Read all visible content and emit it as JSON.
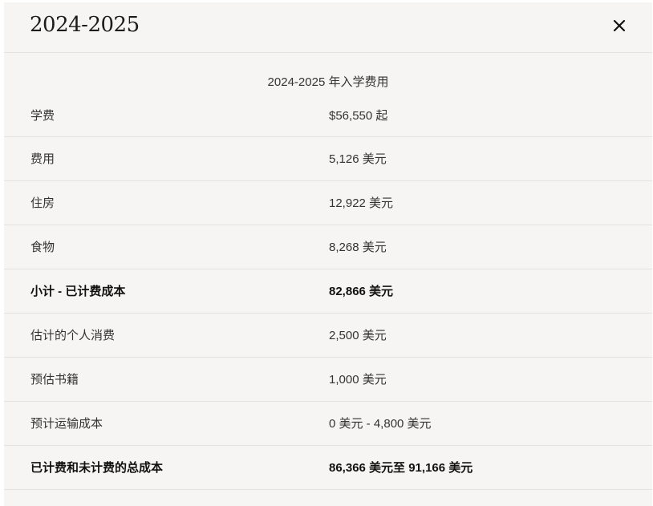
{
  "header": {
    "title": "2024-2025",
    "close_icon": "close-icon"
  },
  "table": {
    "caption": "2024-2025 年入学费用",
    "rows": [
      {
        "label": "学费",
        "value": "$56,550 起",
        "bold": false
      },
      {
        "label": "费用",
        "value": "5,126 美元",
        "bold": false
      },
      {
        "label": "住房",
        "value": "12,922 美元",
        "bold": false
      },
      {
        "label": "食物",
        "value": "8,268 美元",
        "bold": false
      },
      {
        "label": "小计 - 已计费成本",
        "value": "82,866 美元",
        "bold": true
      },
      {
        "label": "估计的个人消费",
        "value": "2,500 美元",
        "bold": false
      },
      {
        "label": "预估书籍",
        "value": "1,000 美元",
        "bold": false
      },
      {
        "label": "预计运输成本",
        "value": "0 美元 - 4,800 美元",
        "bold": false
      },
      {
        "label": "已计费和未计费的总成本",
        "value": "86,366 美元至 91,166 美元",
        "bold": true
      }
    ]
  }
}
